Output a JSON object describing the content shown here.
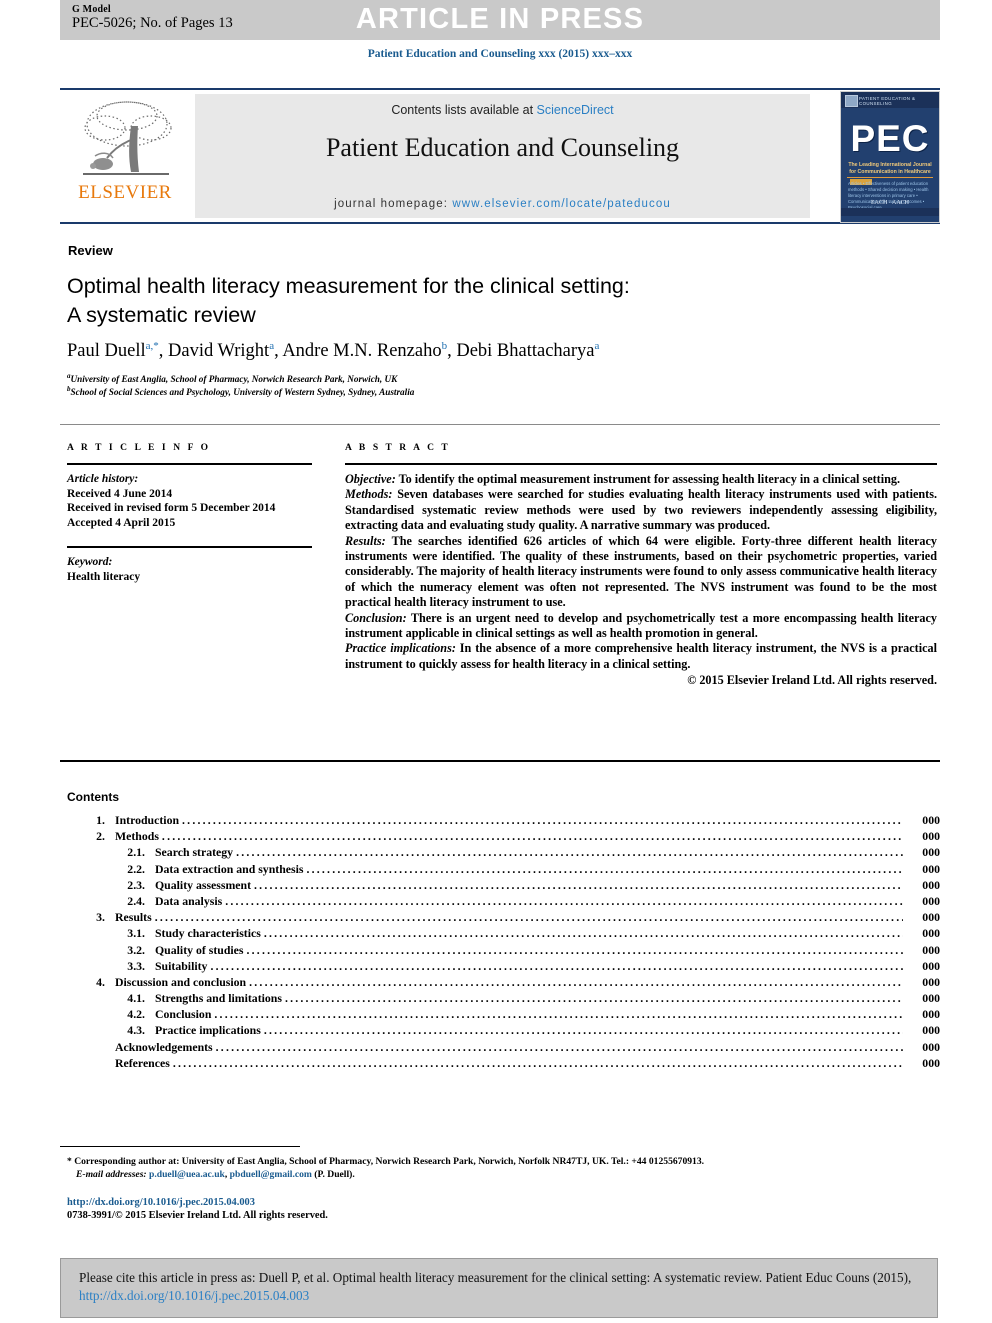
{
  "banner": {
    "g_model": "G Model",
    "pec_pages": "PEC-5026; No. of Pages 13",
    "article_in_press": "ARTICLE IN PRESS"
  },
  "journal_line": "Patient Education and Counseling xxx (2015) xxx–xxx",
  "masthead": {
    "contents_prefix": "Contents lists available at ",
    "sciencedirect": "ScienceDirect",
    "journal_title": "Patient Education and Counseling",
    "homepage_prefix": "journal homepage: ",
    "homepage_url": "www.elsevier.com/locate/pateducou",
    "elsevier_wordmark": "ELSEVIER",
    "cover": {
      "top_bar_text": "PATIENT EDUCATION & COUNSELING",
      "acronym": "PEC",
      "tagline": "The Leading International Journal for Communication in Healthcare",
      "list": "Articles\n• Effectiveness of patient education methods\n• Shared decision making\n• Health literacy interventions in primary care\n• Communication skills training outcomes\n• Psychosocial care",
      "society_logos": "EACH  ·  AACH"
    }
  },
  "article": {
    "section_label": "Review",
    "title": "Optimal health literacy measurement for the clinical setting: A systematic review",
    "title_line1": "Optimal health literacy measurement for the clinical setting:",
    "title_line2": "A systematic review",
    "authors": [
      {
        "name": "Paul Duell",
        "marks": "a,*"
      },
      {
        "name": "David Wright",
        "marks": "a"
      },
      {
        "name": "Andre M.N. Renzaho",
        "marks": "b"
      },
      {
        "name": "Debi Bhattacharya",
        "marks": "a"
      }
    ],
    "affiliations": [
      {
        "mark": "a",
        "text": "University of East Anglia, School of Pharmacy, Norwich Research Park, Norwich, UK"
      },
      {
        "mark": "b",
        "text": "School of Social Sciences and Psychology, University of Western Sydney, Sydney, Australia"
      }
    ]
  },
  "article_info": {
    "heading": "A R T I C L E   I N F O",
    "history_label": "Article history:",
    "history": [
      "Received 4 June 2014",
      "Received in revised form 5 December 2014",
      "Accepted 4 April 2015"
    ],
    "keyword_label": "Keyword:",
    "keywords": [
      "Health literacy"
    ]
  },
  "abstract": {
    "heading": "A B S T R A C T",
    "sections": [
      {
        "label": "Objective:",
        "text": " To identify the optimal measurement instrument for assessing health literacy in a clinical setting."
      },
      {
        "label": "Methods:",
        "text": " Seven databases were searched for studies evaluating health literacy instruments used with patients. Standardised systematic review methods were used by two reviewers independently assessing eligibility, extracting data and evaluating study quality. A narrative summary was produced."
      },
      {
        "label": "Results:",
        "text": " The searches identified 626 articles of which 64 were eligible. Forty-three different health literacy instruments were identified. The quality of these instruments, based on their psychometric properties, varied considerably. The majority of health literacy instruments were found to only assess communicative health literacy of which the numeracy element was often not represented. The NVS instrument was found to be the most practical health literacy instrument to use."
      },
      {
        "label": "Conclusion:",
        "text": " There is an urgent need to develop and psychometrically test a more encompassing health literacy instrument applicable in clinical settings as well as health promotion in general."
      },
      {
        "label": "Practice implications:",
        "text": " In the absence of a more comprehensive health literacy instrument, the NVS is a practical instrument to quickly assess for health literacy in a clinical setting."
      }
    ],
    "copyright": "© 2015 Elsevier Ireland Ltd. All rights reserved."
  },
  "contents": {
    "heading": "Contents",
    "items": [
      {
        "num": "1.",
        "label": "Introduction",
        "page": "000",
        "level": 1
      },
      {
        "num": "2.",
        "label": "Methods",
        "page": "000",
        "level": 1
      },
      {
        "num": "2.1.",
        "label": "Search strategy",
        "page": "000",
        "level": 2
      },
      {
        "num": "2.2.",
        "label": "Data extraction and synthesis",
        "page": "000",
        "level": 2
      },
      {
        "num": "2.3.",
        "label": "Quality assessment",
        "page": "000",
        "level": 2
      },
      {
        "num": "2.4.",
        "label": "Data analysis",
        "page": "000",
        "level": 2
      },
      {
        "num": "3.",
        "label": "Results",
        "page": "000",
        "level": 1
      },
      {
        "num": "3.1.",
        "label": "Study characteristics",
        "page": "000",
        "level": 2
      },
      {
        "num": "3.2.",
        "label": "Quality of studies",
        "page": "000",
        "level": 2
      },
      {
        "num": "3.3.",
        "label": "Suitability",
        "page": "000",
        "level": 2
      },
      {
        "num": "4.",
        "label": "Discussion and conclusion",
        "page": "000",
        "level": 1
      },
      {
        "num": "4.1.",
        "label": "Strengths and limitations",
        "page": "000",
        "level": 2
      },
      {
        "num": "4.2.",
        "label": "Conclusion",
        "page": "000",
        "level": 2
      },
      {
        "num": "4.3.",
        "label": "Practice implications",
        "page": "000",
        "level": 2
      },
      {
        "num": "",
        "label": "Acknowledgements",
        "page": "000",
        "level": 1
      },
      {
        "num": "",
        "label": "References",
        "page": "000",
        "level": 1
      }
    ]
  },
  "footnotes": {
    "corresponding": "* Corresponding author at: University of East Anglia, School of Pharmacy, Norwich Research Park, Norwich, Norfolk NR47TJ, UK. Tel.: +44 01255670913.",
    "email_label": "E-mail addresses:",
    "email1": "p.duell@uea.ac.uk",
    "email2": "pbduell@gmail.com",
    "email_suffix": "(P. Duell).",
    "doi": "http://dx.doi.org/10.1016/j.pec.2015.04.003",
    "issn": "0738-3991/© 2015 Elsevier Ireland Ltd. All rights reserved."
  },
  "cite_box": {
    "line1": "Please cite this article in press as: Duell P, et al. Optimal health literacy measurement for the clinical setting: A systematic review.",
    "line2_prefix": "Patient Educ Couns (2015), ",
    "line2_link": "http://dx.doi.org/10.1016/j.pec.2015.04.003"
  },
  "colors": {
    "banner_gray": "#c9c9c9",
    "journal_blue": "#1a5b8f",
    "link_blue": "#2a7fc4",
    "elsevier_orange": "#e8790c",
    "masthead_rule": "#1a3a6b"
  }
}
